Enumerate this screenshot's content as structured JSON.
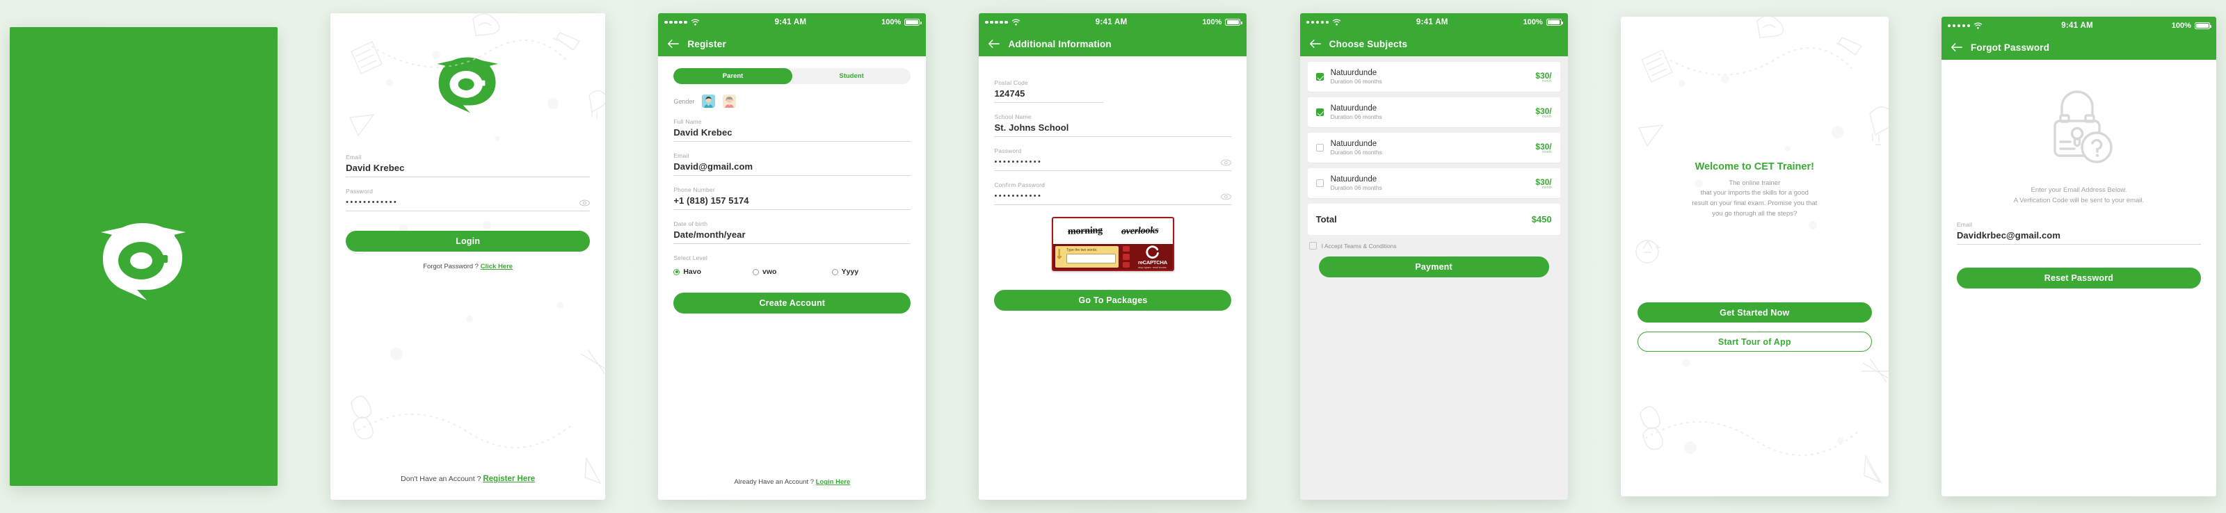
{
  "brand": {
    "primary_green": "#3aaa35",
    "logo_name": "e-graduation-cap-speech-bubble-logo"
  },
  "status_bar": {
    "signal": "•••••",
    "wifi_icon": "wifi-icon",
    "time": "9:41 AM",
    "battery_text": "100%"
  },
  "screens": {
    "splash": {
      "name": "splash-screen"
    },
    "login": {
      "email": {
        "label": "Email",
        "value": "David Krebec"
      },
      "password": {
        "label": "Password",
        "value": "••••••••••••"
      },
      "login_button": "Login",
      "forgot_prefix": "Forgot Password ?",
      "forgot_link": "Click Here",
      "register_prefix": "Don't Have an Account ?",
      "register_link": "Register Here"
    },
    "register": {
      "nav_title": "Register",
      "tab_parent": "Parent",
      "tab_student": "Student",
      "gender_label": "Gender",
      "gender_male_icon": "male-avatar-icon",
      "gender_female_icon": "female-avatar-icon",
      "full_name": {
        "label": "Full Name",
        "value": "David Krebec"
      },
      "email": {
        "label": "Email",
        "value": "David@gmail.com"
      },
      "phone": {
        "label": "Phone Number",
        "value": "+1 (818) 157 5174"
      },
      "dob": {
        "label": "Date of birth",
        "value": "Date/month/year"
      },
      "level_label": "Select Level",
      "levels": [
        {
          "label": "Havo",
          "selected": true
        },
        {
          "label": "vwo",
          "selected": false
        },
        {
          "label": "Yyyy",
          "selected": false
        }
      ],
      "create_button": "Create Account",
      "login_prefix": "Already Have an Account ?",
      "login_link": "Login Here"
    },
    "additional": {
      "nav_title": "Additional Information",
      "postal": {
        "label": "Postal Code",
        "value": "124745"
      },
      "school": {
        "label": "School Name",
        "value": "St. Johns School"
      },
      "password": {
        "label": "Password",
        "value": "•••••••••••"
      },
      "confirm_password": {
        "label": "Confirm Password",
        "value": "•••••••••••"
      },
      "captcha": {
        "word1": "morning",
        "word2": "overlooks",
        "hint": "Type the two words:",
        "input_value": "",
        "brand": "reCAPTCHA",
        "tagline": "stop spam. read books."
      },
      "packages_button": "Go To Packages"
    },
    "subjects": {
      "nav_title": "Choose Subjects",
      "items": [
        {
          "name": "Natuurdunde",
          "duration": "Duration 06 months",
          "price": "$30/",
          "price_unit": "month",
          "checked": true
        },
        {
          "name": "Natuurdunde",
          "duration": "Duration 06 months",
          "price": "$30/",
          "price_unit": "month",
          "checked": true
        },
        {
          "name": "Natuurdunde",
          "duration": "Duration 06 months",
          "price": "$30/",
          "price_unit": "month",
          "checked": false
        },
        {
          "name": "Natuurdunde",
          "duration": "Duration 06 months",
          "price": "$30/",
          "price_unit": "month",
          "checked": false
        }
      ],
      "total_label": "Total",
      "total_value": "$450",
      "terms_label": "I Accept Teams & Conditions",
      "terms_checked": false,
      "payment_button": "Payment"
    },
    "welcome": {
      "title": "Welcome to CET Trainer!",
      "subtitle": "The online trainer\nthat your imports the skills for a good\nresult on your final exam. Promise you that\nyou go thorugh all the steps?",
      "primary_button": "Get Started Now",
      "secondary_button": "Start Tour of App"
    },
    "forgot": {
      "nav_title": "Forgot Password",
      "lock_icon": "lock-question-icon",
      "copy": "Enter your Email Address Below.\nA Verfication Code will be sent to your email.",
      "email": {
        "label": "Email",
        "value": "Davidkrbec@gmail.com"
      },
      "reset_button": "Reset Password"
    }
  }
}
